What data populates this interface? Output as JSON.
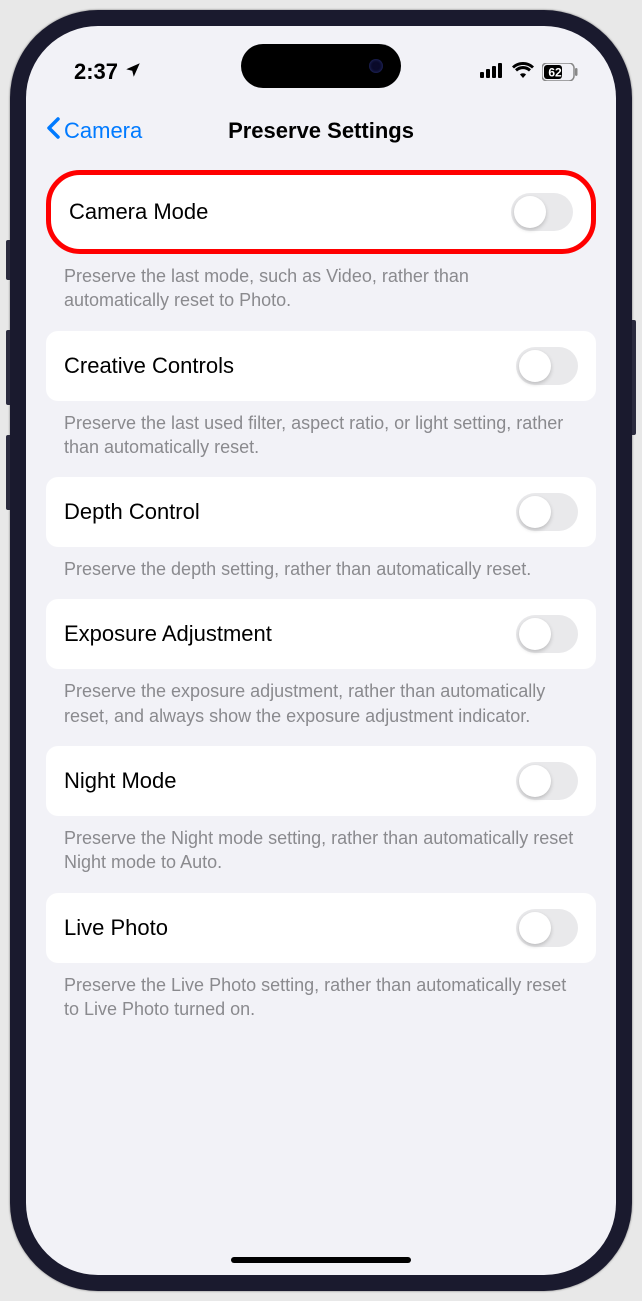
{
  "status": {
    "time": "2:37",
    "battery": "62"
  },
  "nav": {
    "back_label": "Camera",
    "title": "Preserve Settings"
  },
  "settings": [
    {
      "label": "Camera Mode",
      "description": "Preserve the last mode, such as Video, rather than automatically reset to Photo.",
      "enabled": false,
      "highlighted": true
    },
    {
      "label": "Creative Controls",
      "description": "Preserve the last used filter, aspect ratio, or light setting, rather than automatically reset.",
      "enabled": false,
      "highlighted": false
    },
    {
      "label": "Depth Control",
      "description": "Preserve the depth setting, rather than automatically reset.",
      "enabled": false,
      "highlighted": false
    },
    {
      "label": "Exposure Adjustment",
      "description": "Preserve the exposure adjustment, rather than automatically reset, and always show the exposure adjustment indicator.",
      "enabled": false,
      "highlighted": false
    },
    {
      "label": "Night Mode",
      "description": "Preserve the Night mode setting, rather than automatically reset Night mode to Auto.",
      "enabled": false,
      "highlighted": false
    },
    {
      "label": "Live Photo",
      "description": "Preserve the Live Photo setting, rather than automatically reset to Live Photo turned on.",
      "enabled": false,
      "highlighted": false
    }
  ]
}
